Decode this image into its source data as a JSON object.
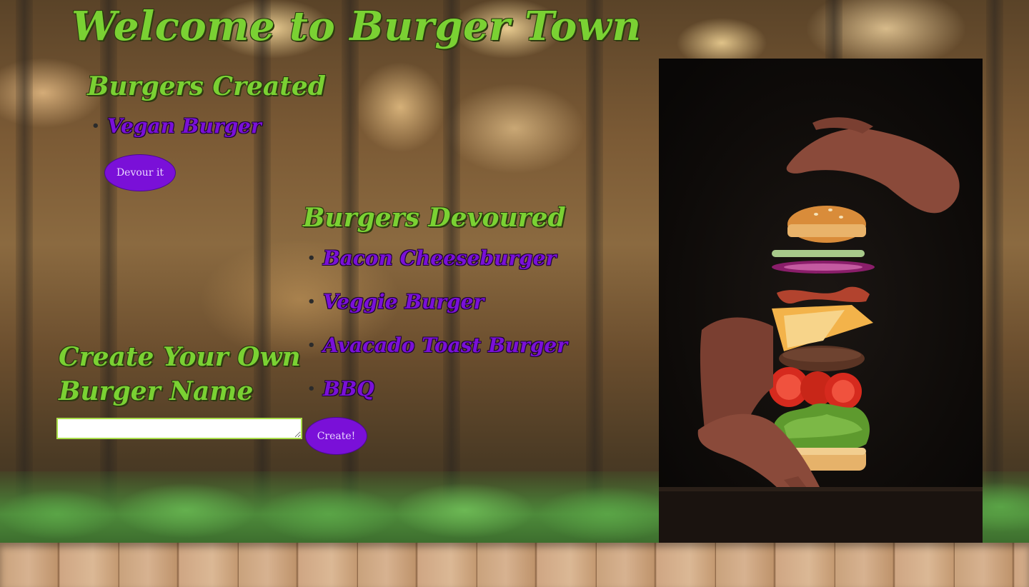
{
  "page": {
    "title": "Welcome to Burger Town"
  },
  "created": {
    "heading": "Burgers Created",
    "items": [
      "Vegan Burger"
    ],
    "devour_label": "Devour it"
  },
  "devoured": {
    "heading": "Burgers Devoured",
    "items": [
      "Bacon Cheeseburger",
      "Veggie Burger",
      "Avacado Toast Burger",
      "BBQ"
    ]
  },
  "form": {
    "heading": "Create Your Own Burger Name",
    "input_value": "",
    "submit_label": "Create!"
  },
  "colors": {
    "heading_green": "#7ad133",
    "list_purple": "#7a10d8",
    "button_purple": "#7a10d8"
  },
  "icons": {
    "bullet": "bullet-icon"
  }
}
